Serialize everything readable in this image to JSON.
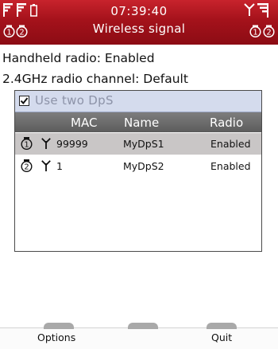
{
  "header": {
    "time": "07:39:40",
    "title": "Wireless signal",
    "icons": [
      "signal-bars-icon",
      "signal-bars-icon",
      "battery-icon",
      "antenna-icon",
      "menu-lines-icon",
      "dps1-icon",
      "dps2-icon"
    ]
  },
  "info": {
    "handheld_radio": "Handheld radio: Enabled",
    "radio_channel": "2.4GHz radio channel: Default"
  },
  "panel": {
    "checkbox_label": "Use two DpS",
    "checkbox_checked": true,
    "columns": {
      "mac": "MAC",
      "name": "Name",
      "radio": "Radio"
    },
    "rows": [
      {
        "index_icon": "dps1-icon",
        "signal_icon": "antenna-icon",
        "mac": "99999",
        "name": "MyDpS1",
        "radio": "Enabled",
        "selected": true
      },
      {
        "index_icon": "dps2-icon",
        "signal_icon": "antenna-icon",
        "mac": "1",
        "name": "MyDpS2",
        "radio": "Enabled",
        "selected": false
      }
    ]
  },
  "softkeys": {
    "left": "Options",
    "middle": "",
    "right": "Quit"
  },
  "colors": {
    "header": "#a4121b",
    "selected_row": "#c9c6c6",
    "table_header": "#6b6b6b",
    "checkbox_row": "#d4dbed"
  }
}
